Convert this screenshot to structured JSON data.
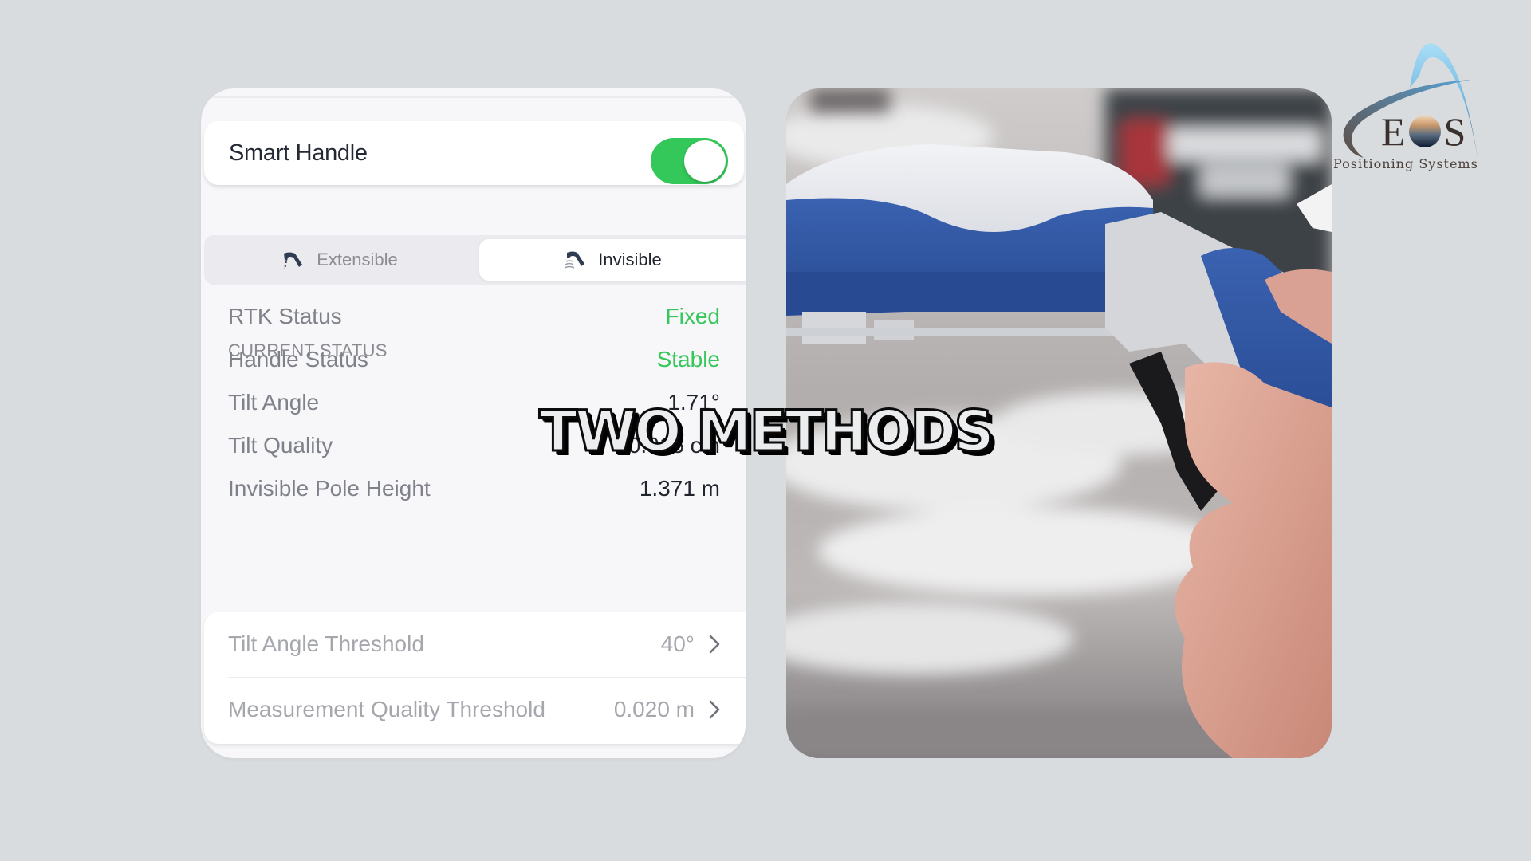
{
  "app": {
    "smart_handle": {
      "label": "Smart Handle",
      "enabled": true
    },
    "mode_segment": {
      "options": [
        {
          "label": "Extensible",
          "icon": "extensible-pole-icon",
          "selected": false
        },
        {
          "label": "Invisible",
          "icon": "invisible-pole-icon",
          "selected": true
        }
      ]
    },
    "current_status": {
      "header": "CURRENT STATUS",
      "rows": [
        {
          "label": "RTK Status",
          "value": "Fixed",
          "color": "#34c759"
        },
        {
          "label": "Handle Status",
          "value": "Stable",
          "color": "#34c759"
        },
        {
          "label": "Tilt Angle",
          "value": "1.71°"
        },
        {
          "label": "Tilt Quality",
          "value": "0.015 cm"
        },
        {
          "label": "Invisible Pole Height",
          "value": "1.371 m"
        }
      ]
    },
    "thresholds": [
      {
        "label": "Tilt Angle Threshold",
        "value": "40°"
      },
      {
        "label": "Measurement Quality Threshold",
        "value": "0.020 m"
      }
    ]
  },
  "overlay": {
    "title": "TWO METHODS"
  },
  "logo": {
    "brand": "EOS",
    "brand_left": "E",
    "brand_right": "S",
    "tagline": "Positioning Systems"
  },
  "photo": {
    "description": "GNSS receiver with blue smart handle held in hand over snowy ground"
  },
  "colors": {
    "accent_green": "#34c759",
    "background": "#d9dcdf",
    "receiver_blue": "#2e54a0"
  }
}
